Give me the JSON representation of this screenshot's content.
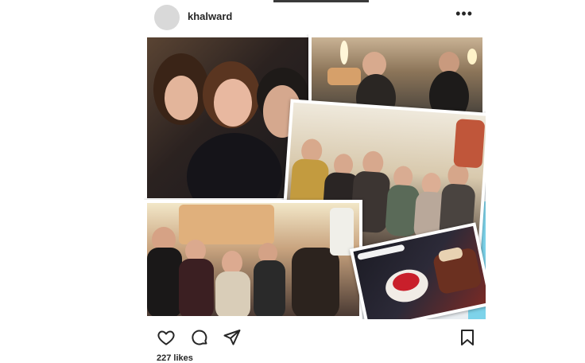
{
  "post": {
    "username": "khalward",
    "more_label": "•••",
    "likes_label": "227 likes"
  },
  "icons": {
    "more": "more-options-icon",
    "like": "heart-icon",
    "comment": "comment-icon",
    "share": "send-icon",
    "save": "bookmark-icon"
  },
  "colors": {
    "text": "#262626",
    "accent_cyan": "#7dd3ea"
  }
}
